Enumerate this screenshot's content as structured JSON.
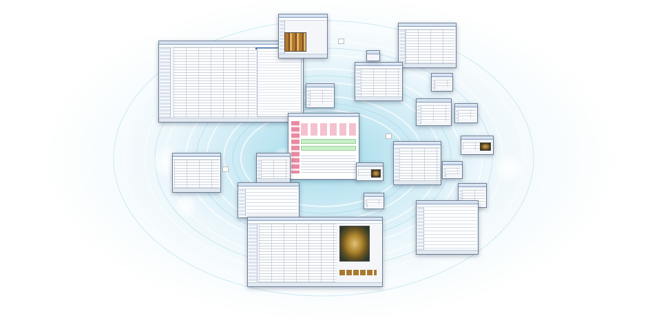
{
  "scene": {
    "description": "",
    "accent_color": "#3f6fb5",
    "background_glow_color": "#9fd8e6"
  },
  "windows": [
    {
      "id": "main-form",
      "label": ""
    },
    {
      "id": "photo-card-top",
      "label": ""
    },
    {
      "id": "spreadsheet-top-right",
      "label": ""
    },
    {
      "id": "spreadsheet-mid",
      "label": ""
    },
    {
      "id": "report-center",
      "label": ""
    },
    {
      "id": "photo-record-bottom",
      "label": ""
    }
  ]
}
